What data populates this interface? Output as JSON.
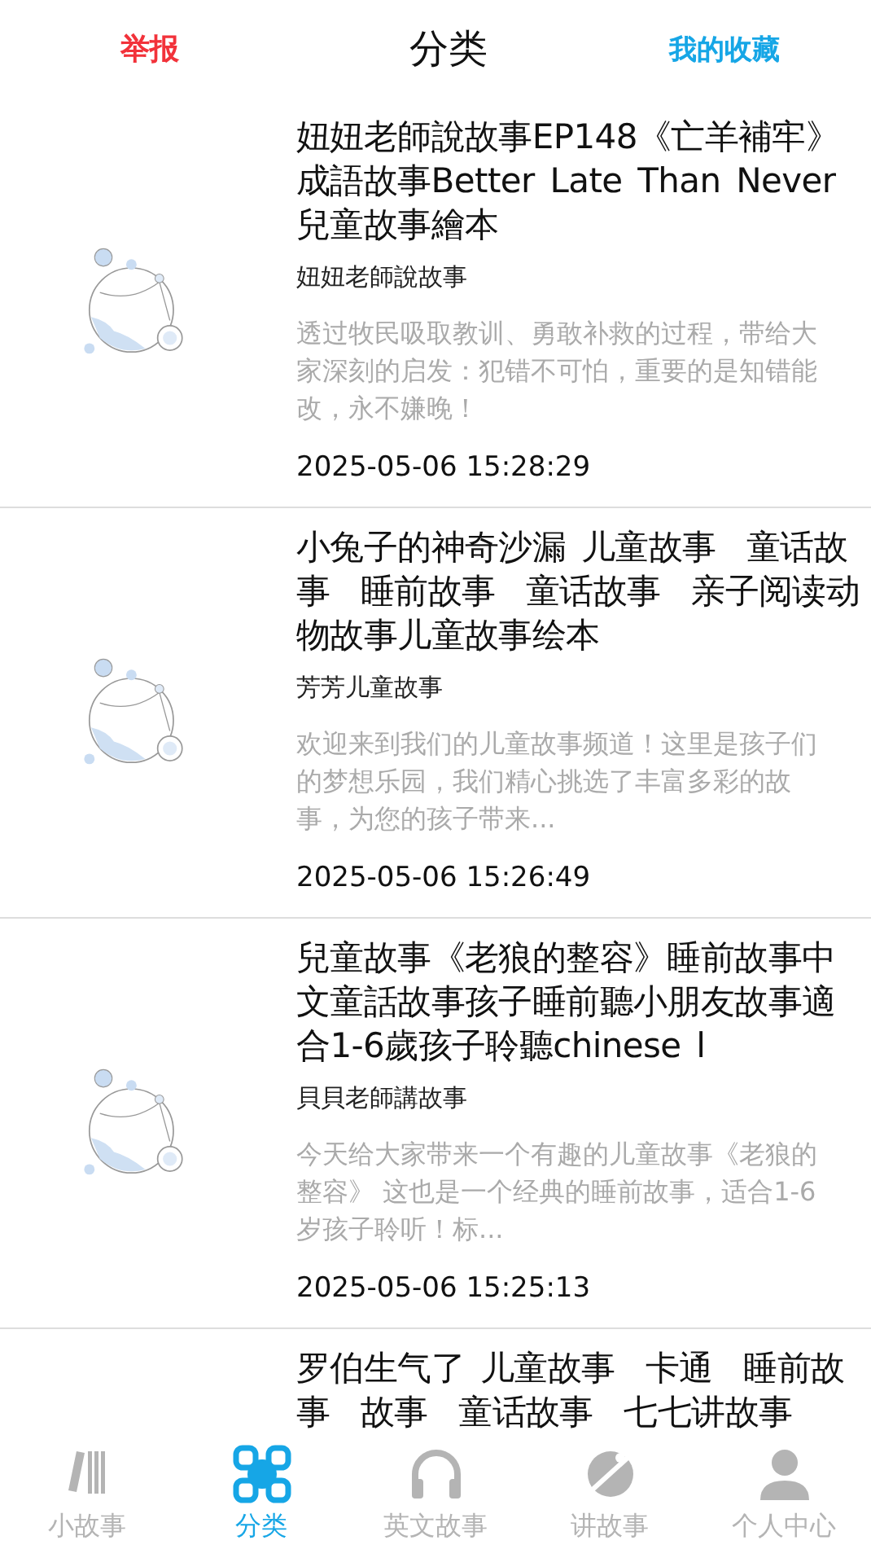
{
  "header": {
    "left_link": "举报",
    "title": "分类",
    "right_link": "我的收藏"
  },
  "stories": [
    {
      "title": "妞妞老師說故事EP148《亡羊補牢》成語故事Better Late Than Never兒童故事繪本",
      "author": "妞妞老師說故事",
      "description": "透过牧民吸取教训、勇敢补救的过程，带给大家深刻的启发：犯错不可怕，重要的是知错能改，永不嫌晚！",
      "date": "2025-05-06 15:28:29"
    },
    {
      "title": "小兔子的神奇沙漏 儿童故事  童话故事  睡前故事  童话故事  亲子阅读动物故事儿童故事绘本",
      "author": "芳芳儿童故事",
      "description": "欢迎来到我们的儿童故事频道！这里是孩子们的梦想乐园，我们精心挑选了丰富多彩的故事，为您的孩子带来...",
      "date": "2025-05-06 15:26:49"
    },
    {
      "title": "兒童故事《老狼的整容》睡前故事中文童話故事孩子睡前聽小朋友故事適合1-6歲孩子聆聽chinese l",
      "author": "貝貝老師講故事",
      "description": "今天给大家带来一个有趣的儿童故事《老狼的整容》 这也是一个经典的睡前故事，适合1-6岁孩子聆听！标...",
      "date": "2025-05-06 15:25:13"
    },
    {
      "title": "罗伯生气了 儿童故事  卡通  睡前故事  故事  童话故事  七七讲故事"
    }
  ],
  "tabs": [
    {
      "label": "小故事",
      "kind": "books",
      "selected": false
    },
    {
      "label": "分类",
      "kind": "grid",
      "selected": true
    },
    {
      "label": "英文故事",
      "kind": "headphones",
      "selected": false
    },
    {
      "label": "讲故事",
      "kind": "planet",
      "selected": false
    },
    {
      "label": "个人中心",
      "kind": "person",
      "selected": false
    }
  ]
}
